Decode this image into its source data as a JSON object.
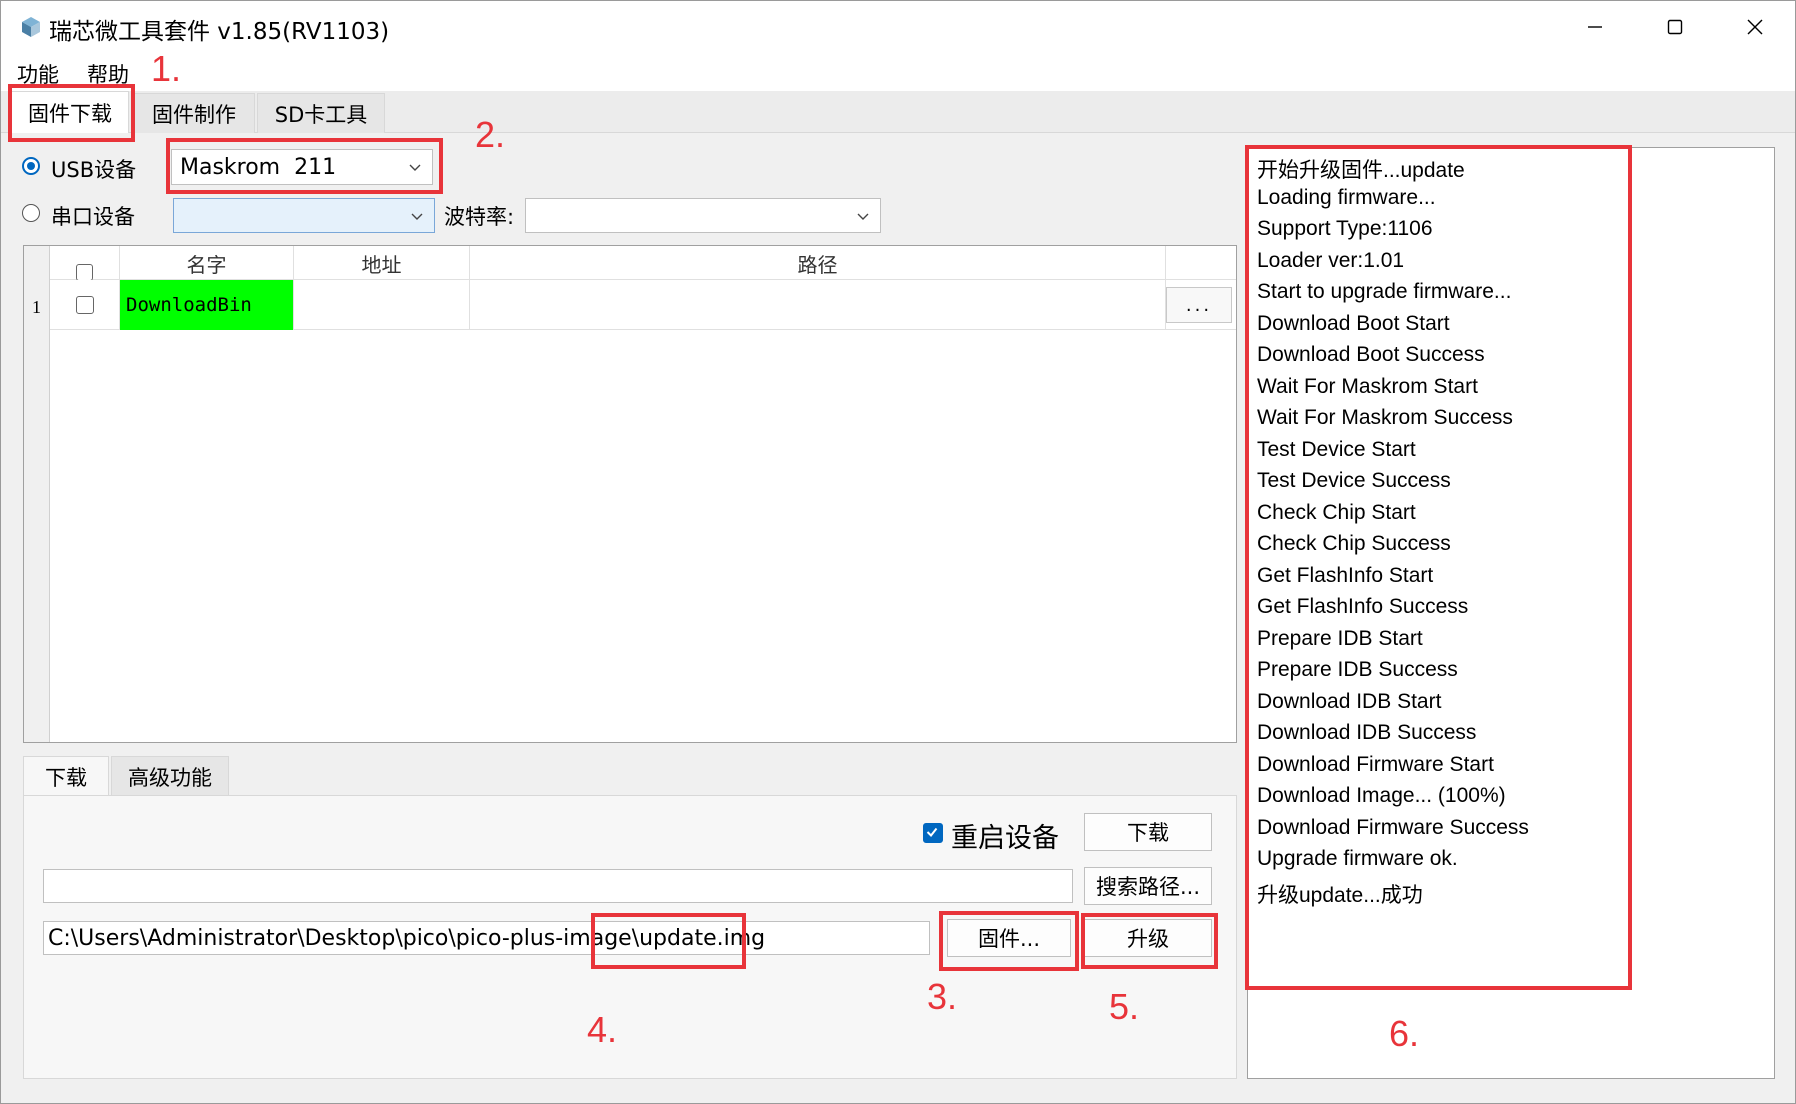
{
  "window": {
    "title": "瑞芯微工具套件 v1.85(RV1103)",
    "icons": {
      "app": "app-cube-icon",
      "minimize": "minimize-icon",
      "maximize": "maximize-icon",
      "close": "close-icon"
    }
  },
  "menu": {
    "items": [
      "功能",
      "帮助"
    ]
  },
  "tabs": [
    {
      "label": "固件下载",
      "active": true
    },
    {
      "label": "固件制作",
      "active": false
    },
    {
      "label": "SD卡工具",
      "active": false
    }
  ],
  "device": {
    "usb_label": "USB设备",
    "usb_selected": true,
    "usb_value": "Maskrom  211",
    "serial_label": "串口设备",
    "serial_value": "",
    "baud_label": "波特率:",
    "baud_value": ""
  },
  "grid": {
    "columns": [
      "名字",
      "地址",
      "路径"
    ],
    "rows": [
      {
        "index": "1",
        "name": "DownloadBin",
        "address": "",
        "path": "",
        "browse": "...",
        "checked": false
      }
    ]
  },
  "subtabs": [
    {
      "label": "下载",
      "active": true
    },
    {
      "label": "高级功能",
      "active": false
    }
  ],
  "download": {
    "restart_label": "重启设备",
    "restart_checked": true,
    "download_button": "下载",
    "search_path_button": "搜索路径...",
    "search_path_value": "",
    "firmware_path": "C:\\Users\\Administrator\\Desktop\\pico\\pico-plus-image\\update.img",
    "firmware_button": "固件...",
    "upgrade_button": "升级"
  },
  "log": {
    "lines": [
      "开始升级固件...update",
      "Loading firmware...",
      "Support Type:1106",
      "Loader ver:1.01",
      "Start to upgrade firmware...",
      "Download Boot Start",
      "Download Boot Success",
      "Wait For Maskrom Start",
      "Wait For Maskrom Success",
      "Test Device Start",
      "Test Device Success",
      "Check Chip Start",
      "Check Chip Success",
      "Get FlashInfo Start",
      "Get FlashInfo Success",
      "Prepare IDB Start",
      "Prepare IDB Success",
      "Download IDB Start",
      "Download IDB Success",
      "Download Firmware Start",
      "Download Image... (100%)",
      "Download Firmware Success",
      "Upgrade firmware ok.",
      "升级update...成功"
    ]
  },
  "annotations": {
    "color": "#e8343a",
    "labels": [
      "1.",
      "2.",
      "3.",
      "4.",
      "5.",
      "6."
    ]
  },
  "colors": {
    "accent": "#0067c0",
    "highlight_cell": "#00ff00"
  }
}
